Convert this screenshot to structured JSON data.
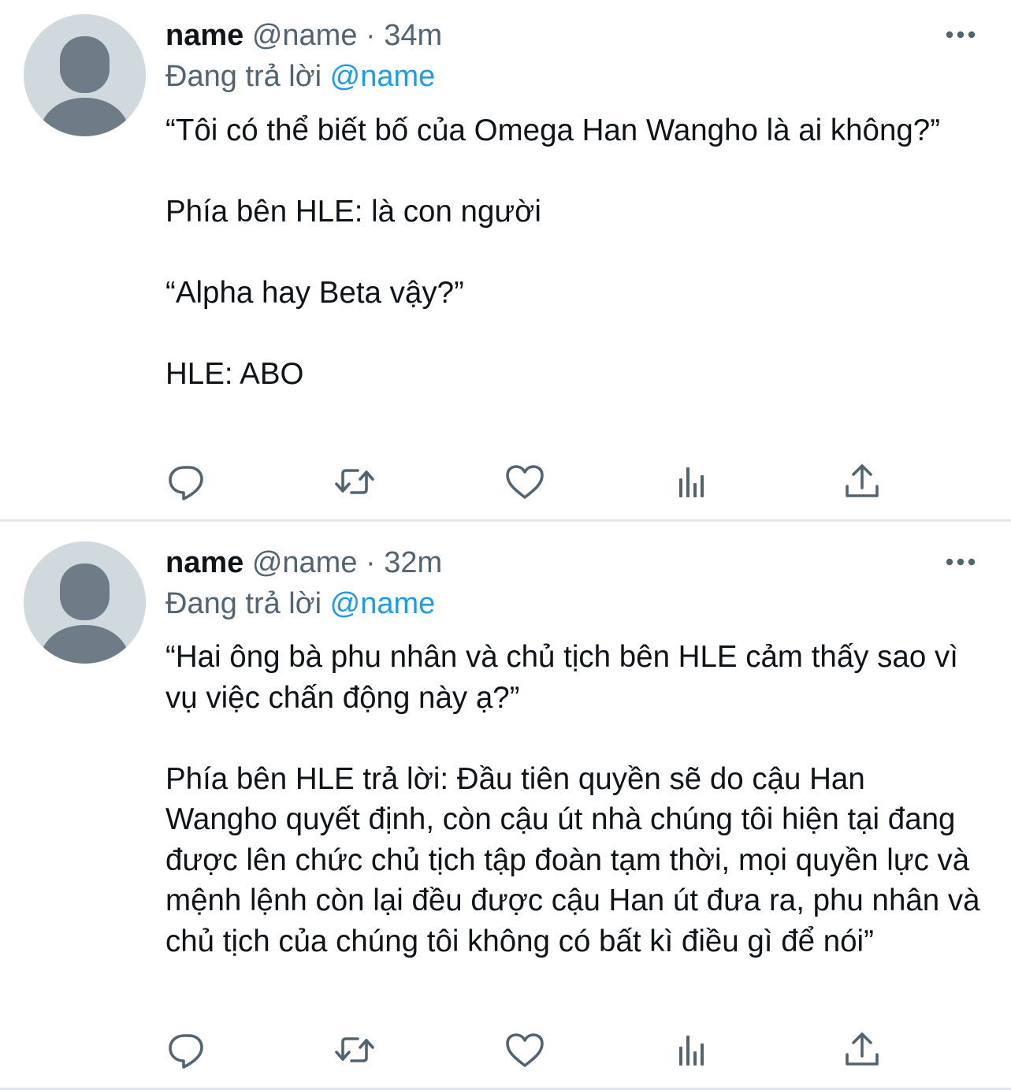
{
  "tweets": [
    {
      "name": "name",
      "handle": "@name",
      "separator": " · ",
      "time": "34m",
      "reply_prefix": "Đang trả lời ",
      "reply_to": "@name",
      "paragraphs": [
        "“Tôi có thể biết bố của Omega Han Wangho là ai không?”",
        "Phía bên HLE: là con người",
        "“Alpha hay Beta vậy?”",
        "HLE: ABO"
      ],
      "actions": [
        "reply-icon",
        "retweet-icon",
        "like-icon",
        "analytics-icon",
        "share-icon"
      ]
    },
    {
      "name": "name",
      "handle": "@name",
      "separator": " · ",
      "time": "32m",
      "reply_prefix": "Đang trả lời ",
      "reply_to": "@name",
      "paragraphs": [
        "“Hai ông bà phu nhân và chủ tịch bên HLE cảm thấy sao vì vụ việc chấn động này ạ?”",
        "Phía bên HLE trả lời: Đầu tiên quyền sẽ do cậu Han Wangho quyết định, còn cậu út nhà chúng tôi hiện tại đang được lên chức chủ tịch tập đoàn tạm thời, mọi quyền lực và mệnh lệnh còn lại đều được cậu Han út đưa ra, phu nhân và chủ tịch của chúng tôi không có bất kì điều gì để nói”"
      ],
      "actions": [
        "reply-icon",
        "retweet-icon",
        "like-icon",
        "analytics-icon",
        "share-icon"
      ]
    }
  ],
  "colors": {
    "text": "#0f1419",
    "secondary": "#536471",
    "link": "#1d9bf0",
    "avatar_bg": "#cfd9de",
    "avatar_fg": "#6e7c87",
    "divider": "#e1e8ed"
  }
}
